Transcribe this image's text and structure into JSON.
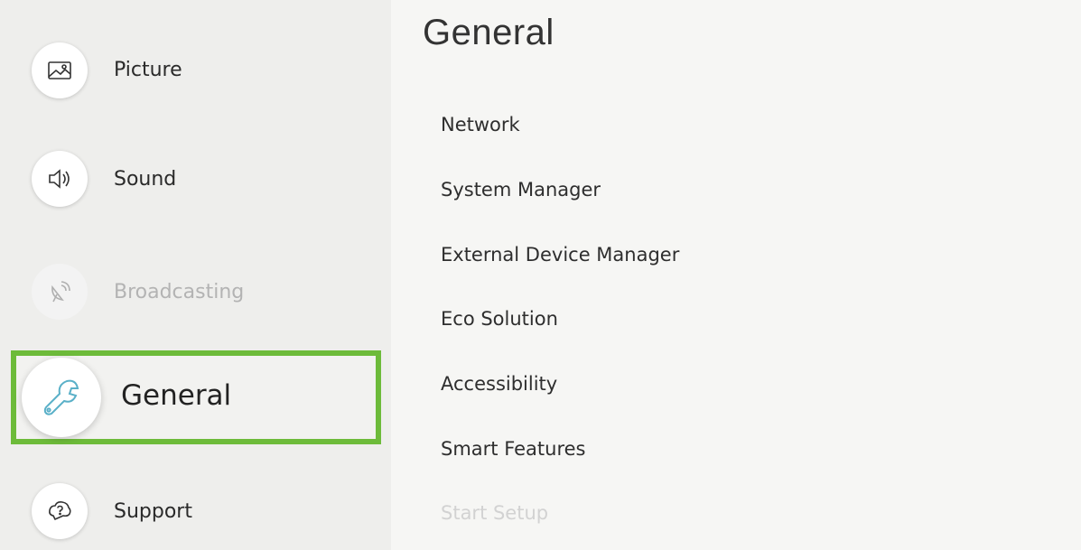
{
  "sidebar": {
    "items": [
      {
        "label": "Picture",
        "icon": "picture-icon",
        "state": "normal"
      },
      {
        "label": "Sound",
        "icon": "speaker-icon",
        "state": "normal"
      },
      {
        "label": "Broadcasting",
        "icon": "satellite-dish-icon",
        "state": "disabled"
      },
      {
        "label": "General",
        "icon": "wrench-icon",
        "state": "selected"
      },
      {
        "label": "Support",
        "icon": "help-bubble-icon",
        "state": "normal"
      }
    ]
  },
  "main": {
    "title": "General",
    "items": [
      {
        "label": "Network"
      },
      {
        "label": "System Manager"
      },
      {
        "label": "External Device Manager"
      },
      {
        "label": "Eco Solution"
      },
      {
        "label": "Accessibility"
      },
      {
        "label": "Smart Features"
      },
      {
        "label": "Start Setup"
      }
    ]
  },
  "colors": {
    "focus_border": "#6dbb3a",
    "wrench_icon": "#5ab0c8"
  }
}
